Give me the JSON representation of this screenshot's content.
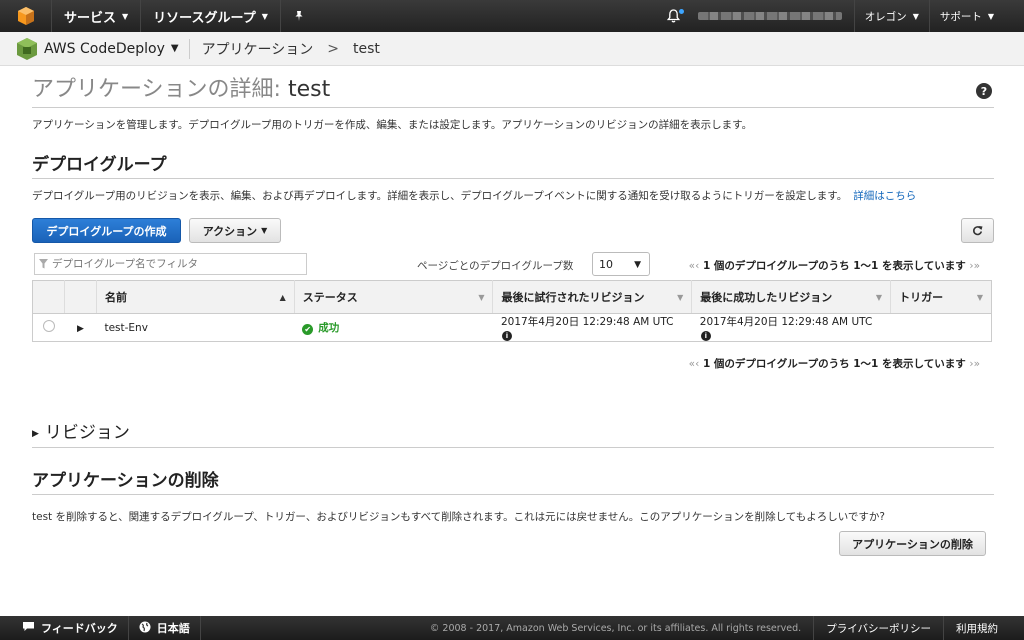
{
  "topnav": {
    "services": "サービス",
    "resource_groups": "リソースグループ",
    "region": "オレゴン",
    "support": "サポート"
  },
  "service_bar": {
    "service_name": "AWS CodeDeploy",
    "breadcrumb_applications": "アプリケーション",
    "breadcrumb_separator": ">",
    "breadcrumb_current": "test"
  },
  "page": {
    "title_prefix": "アプリケーションの詳細: ",
    "title_name": "test",
    "description": "アプリケーションを管理します。デプロイグループ用のトリガーを作成、編集、または設定します。アプリケーションのリビジョンの詳細を表示します。"
  },
  "deployment_groups": {
    "title": "デプロイグループ",
    "description": "デプロイグループ用のリビジョンを表示、編集、および再デプロイします。詳細を表示し、デプロイグループイベントに関する通知を受け取るようにトリガーを設定します。",
    "learn_more": "詳細はこちら",
    "create_button": "デプロイグループの作成",
    "actions_button": "アクション",
    "filter_placeholder": "デプロイグループ名でフィルタ",
    "per_page_label": "ページごとのデプロイグループ数",
    "per_page_value": "10",
    "pager_text": "1 個のデプロイグループのうち 1〜1 を表示しています",
    "columns": [
      "名前",
      "ステータス",
      "最後に試行されたリビジョン",
      "最後に成功したリビジョン",
      "トリガー"
    ],
    "rows": [
      {
        "name": "test-Env",
        "status": "成功",
        "last_attempted": "2017年4月20日 12:29:48 AM UTC",
        "last_succeeded": "2017年4月20日 12:29:48 AM UTC",
        "triggers": ""
      }
    ]
  },
  "revisions": {
    "title": "リビジョン"
  },
  "delete_section": {
    "title": "アプリケーションの削除",
    "description": "test を削除すると、関連するデプロイグループ、トリガー、およびリビジョンもすべて削除されます。これは元には戻せません。このアプリケーションを削除してもよろしいですか?",
    "button": "アプリケーションの削除"
  },
  "footer": {
    "feedback": "フィードバック",
    "language": "日本語",
    "copyright": "© 2008 - 2017, Amazon Web Services, Inc. or its affiliates. All rights reserved.",
    "privacy": "プライバシーポリシー",
    "terms": "利用規約"
  },
  "icons": {
    "aws_logo": "aws-cube-icon",
    "pin": "pin-icon",
    "bell": "bell-icon",
    "help": "help-icon",
    "refresh": "refresh-icon",
    "filter": "filter-icon",
    "success": "check-circle-icon",
    "info": "info-icon",
    "feedback": "speech-bubble-icon",
    "globe": "globe-icon"
  },
  "colors": {
    "nav_bg": "#232f3e",
    "primary": "#1a62b8",
    "success": "#2a9a2a",
    "aws_orange": "#f7981d",
    "codedeploy_green": "#6b9a3f"
  }
}
